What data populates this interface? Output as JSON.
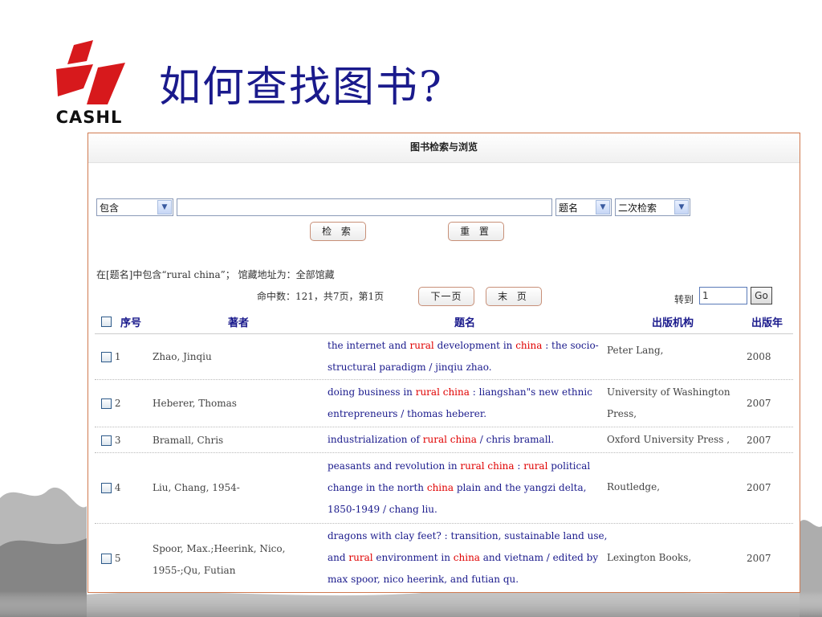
{
  "slide": {
    "logo_text": "CASHL",
    "title": "如何查找图书?"
  },
  "panel": {
    "header": "图书检索与浏览",
    "search": {
      "match_select": "包含",
      "query_value": "",
      "field_select": "题名",
      "mode_select": "二次检索",
      "search_button": "检 索",
      "reset_button": "重 置"
    },
    "query_summary": "在[题名]中包含“rural china”；  馆藏地址为：全部馆藏",
    "stats": "命中数：121，共7页，第1页",
    "next_button": "下一页",
    "last_button": "末 页",
    "goto_label": "转到",
    "goto_value": "1",
    "go_button": "Go"
  },
  "table": {
    "columns": {
      "index": "序号",
      "author": "著者",
      "title": "题名",
      "publisher": "出版机构",
      "year": "出版年"
    },
    "rows": [
      {
        "index": "1",
        "author": "Zhao, Jinqiu",
        "title_parts": [
          {
            "text": "the internet and ",
            "hl": false
          },
          {
            "text": "rural",
            "hl": true
          },
          {
            "text": " development in ",
            "hl": false
          },
          {
            "text": "china",
            "hl": true
          },
          {
            "text": " : the socio-structural paradigm / jinqiu zhao.",
            "hl": false
          }
        ],
        "publisher": "Peter Lang,",
        "year": "2008"
      },
      {
        "index": "2",
        "author": "Heberer, Thomas",
        "title_parts": [
          {
            "text": "doing business in ",
            "hl": false
          },
          {
            "text": "rural china",
            "hl": true
          },
          {
            "text": " : liangshan\"s new ethnic entrepreneurs / thomas heberer.",
            "hl": false
          }
        ],
        "publisher": "University of Washington Press,",
        "year": "2007"
      },
      {
        "index": "3",
        "author": "Bramall, Chris",
        "title_parts": [
          {
            "text": "industrialization of ",
            "hl": false
          },
          {
            "text": "rural china",
            "hl": true
          },
          {
            "text": " / chris bramall.",
            "hl": false
          }
        ],
        "publisher": "Oxford University Press ,",
        "year": "2007"
      },
      {
        "index": "4",
        "author": "Liu, Chang, 1954-",
        "title_parts": [
          {
            "text": "peasants and revolution in ",
            "hl": false
          },
          {
            "text": "rural china",
            "hl": true
          },
          {
            "text": " : ",
            "hl": false
          },
          {
            "text": "rural",
            "hl": true
          },
          {
            "text": " political change in the north ",
            "hl": false
          },
          {
            "text": "china",
            "hl": true
          },
          {
            "text": " plain and the yangzi delta, 1850-1949 / chang liu.",
            "hl": false
          }
        ],
        "publisher": "Routledge,",
        "year": "2007"
      },
      {
        "index": "5",
        "author": "Spoor, Max.;Heerink, Nico, 1955-;Qu, Futian",
        "title_parts": [
          {
            "text": "dragons with clay feet? : transition, sustainable land use, and ",
            "hl": false
          },
          {
            "text": "rural",
            "hl": true
          },
          {
            "text": " environment in ",
            "hl": false
          },
          {
            "text": "china",
            "hl": true
          },
          {
            "text": " and vietnam / edited by max spoor, nico heerink, and futian qu.",
            "hl": false
          }
        ],
        "publisher": "Lexington Books,",
        "year": "2007"
      }
    ]
  },
  "colors": {
    "title_blue": "#1a1a8c",
    "highlight_red": "#e00000",
    "panel_border": "#d07a50",
    "logo_red": "#d7191c"
  }
}
